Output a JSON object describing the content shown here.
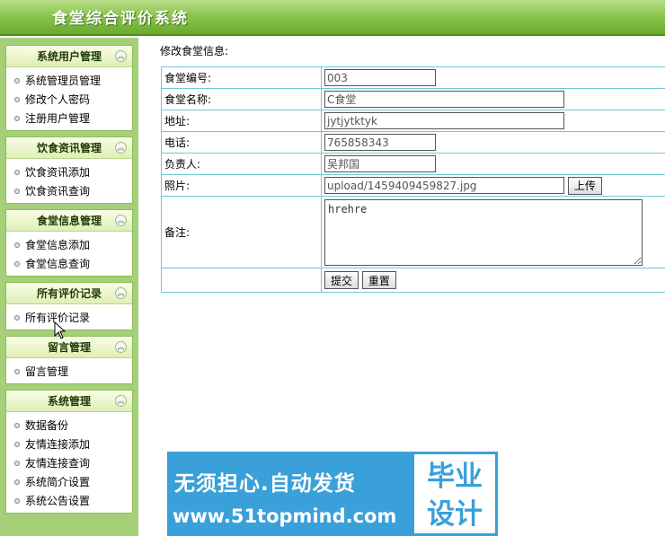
{
  "header": {
    "title": "食堂综合评价系统"
  },
  "sidebar": {
    "groups": [
      {
        "title": "系统用户管理",
        "items": [
          "系统管理员管理",
          "修改个人密码",
          "注册用户管理"
        ]
      },
      {
        "title": "饮食资讯管理",
        "items": [
          "饮食资讯添加",
          "饮食资讯查询"
        ]
      },
      {
        "title": "食堂信息管理",
        "items": [
          "食堂信息添加",
          "食堂信息查询"
        ]
      },
      {
        "title": "所有评价记录",
        "items": [
          "所有评价记录"
        ]
      },
      {
        "title": "留言管理",
        "items": [
          "留言管理"
        ]
      },
      {
        "title": "系统管理",
        "items": [
          "数据备份",
          "友情连接添加",
          "友情连接查询",
          "系统简介设置",
          "系统公告设置"
        ]
      }
    ],
    "collapse_glyph": "︽"
  },
  "main": {
    "heading": "修改食堂信息:",
    "fields": {
      "code": {
        "label": "食堂编号:",
        "value": "003"
      },
      "name": {
        "label": "食堂名称:",
        "value": "C食堂"
      },
      "address": {
        "label": "地址:",
        "value": "jytjytktyk"
      },
      "phone": {
        "label": "电话:",
        "value": "765858343"
      },
      "manager": {
        "label": "负责人:",
        "value": "吴邦国"
      },
      "photo": {
        "label": "照片:",
        "value": "upload/1459409459827.jpg",
        "upload_label": "上传"
      },
      "remark": {
        "label": "备注:",
        "value": "hrehre"
      }
    },
    "submit_label": "提交",
    "reset_label": "重置"
  },
  "watermark": {
    "line1": "无须担心.自动发货",
    "url": "www.51topmind.com",
    "box_line1": "毕业",
    "box_line2": "设计"
  },
  "colors": {
    "header_green": "#6aaa2c",
    "sidebar_bg": "#a5cf78",
    "table_border": "#6fc8d6",
    "watermark_blue": "#3aa0d9"
  }
}
